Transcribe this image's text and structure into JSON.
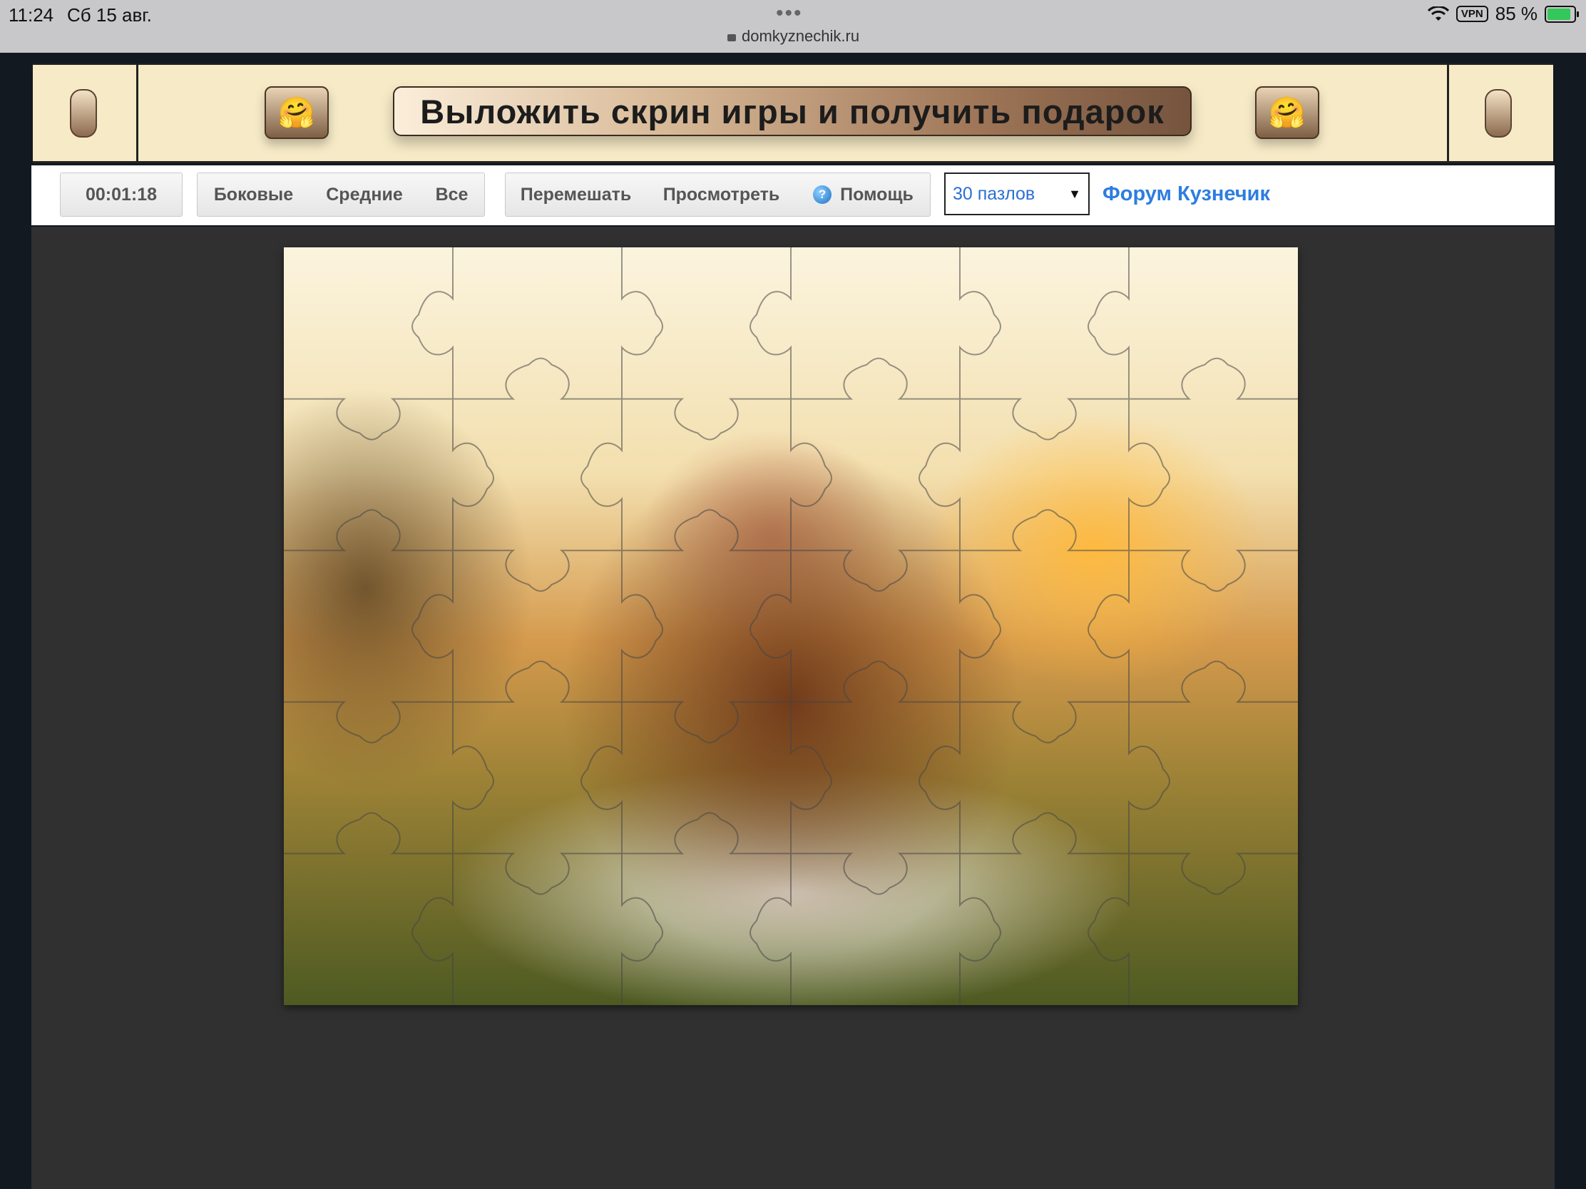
{
  "status_bar": {
    "time": "11:24",
    "date": "Сб 15 авг.",
    "url": "domkyznechik.ru",
    "vpn": "VPN",
    "battery": "85 %"
  },
  "banner": {
    "promo_text": "Выложить скрин игры и получить подарок",
    "emoji": "🤗"
  },
  "toolbar": {
    "timer": "00:01:18",
    "edges_label": "Боковые",
    "middle_label": "Средние",
    "all_label": "Все",
    "shuffle_label": "Перемешать",
    "preview_label": "Просмотреть",
    "help_label": "Помощь",
    "pieces_select": "30 пазлов",
    "forum_link": "Форум Кузнечик"
  },
  "puzzle": {
    "columns": 6,
    "rows": 5
  },
  "colors": {
    "banner_bg": "#f7ebc7",
    "play_area_bg": "#303030",
    "link": "#2d7de0"
  }
}
